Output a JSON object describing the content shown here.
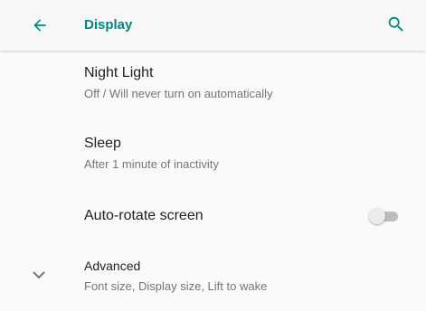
{
  "toolbar": {
    "title": "Display",
    "back_icon": "arrow-back-icon",
    "search_icon": "search-icon"
  },
  "items": [
    {
      "title": "Night Light",
      "summary": "Off / Will never turn on automatically"
    },
    {
      "title": "Sleep",
      "summary": "After 1 minute of inactivity"
    },
    {
      "title": "Auto-rotate screen",
      "toggle_on": false
    },
    {
      "title": "Advanced",
      "summary": "Font size, Display size, Lift to wake",
      "icon": "chevron-down-icon"
    }
  ],
  "colors": {
    "accent": "#00897b",
    "title_text": "#212121",
    "summary_text": "#757575"
  }
}
